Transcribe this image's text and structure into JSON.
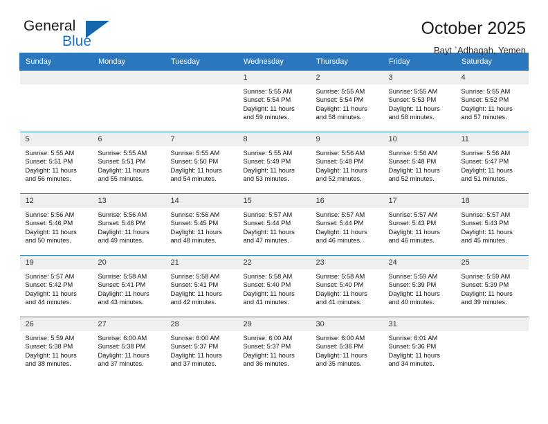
{
  "logo": {
    "word1": "General",
    "word2": "Blue",
    "triangle_color": "#1466ab",
    "blue_color": "#1f77c2"
  },
  "header": {
    "title": "October 2025",
    "subtitle": "Bayt `Adhaqah, Yemen",
    "accent_color": "#2a77bd"
  },
  "weekdays": [
    "Sunday",
    "Monday",
    "Tuesday",
    "Wednesday",
    "Thursday",
    "Friday",
    "Saturday"
  ],
  "labels": {
    "sunrise": "Sunrise:",
    "sunset": "Sunset:",
    "daylight": "Daylight:"
  },
  "weeks": [
    [
      {
        "day": "",
        "empty": true
      },
      {
        "day": "",
        "empty": true
      },
      {
        "day": "",
        "empty": true
      },
      {
        "day": "1",
        "sunrise": "Sunrise: 5:55 AM",
        "sunset": "Sunset: 5:54 PM",
        "daylight_l1": "Daylight: 11 hours",
        "daylight_l2": "and 59 minutes."
      },
      {
        "day": "2",
        "sunrise": "Sunrise: 5:55 AM",
        "sunset": "Sunset: 5:54 PM",
        "daylight_l1": "Daylight: 11 hours",
        "daylight_l2": "and 58 minutes."
      },
      {
        "day": "3",
        "sunrise": "Sunrise: 5:55 AM",
        "sunset": "Sunset: 5:53 PM",
        "daylight_l1": "Daylight: 11 hours",
        "daylight_l2": "and 58 minutes."
      },
      {
        "day": "4",
        "sunrise": "Sunrise: 5:55 AM",
        "sunset": "Sunset: 5:52 PM",
        "daylight_l1": "Daylight: 11 hours",
        "daylight_l2": "and 57 minutes."
      }
    ],
    [
      {
        "day": "5",
        "sunrise": "Sunrise: 5:55 AM",
        "sunset": "Sunset: 5:51 PM",
        "daylight_l1": "Daylight: 11 hours",
        "daylight_l2": "and 56 minutes."
      },
      {
        "day": "6",
        "sunrise": "Sunrise: 5:55 AM",
        "sunset": "Sunset: 5:51 PM",
        "daylight_l1": "Daylight: 11 hours",
        "daylight_l2": "and 55 minutes."
      },
      {
        "day": "7",
        "sunrise": "Sunrise: 5:55 AM",
        "sunset": "Sunset: 5:50 PM",
        "daylight_l1": "Daylight: 11 hours",
        "daylight_l2": "and 54 minutes."
      },
      {
        "day": "8",
        "sunrise": "Sunrise: 5:55 AM",
        "sunset": "Sunset: 5:49 PM",
        "daylight_l1": "Daylight: 11 hours",
        "daylight_l2": "and 53 minutes."
      },
      {
        "day": "9",
        "sunrise": "Sunrise: 5:56 AM",
        "sunset": "Sunset: 5:48 PM",
        "daylight_l1": "Daylight: 11 hours",
        "daylight_l2": "and 52 minutes."
      },
      {
        "day": "10",
        "sunrise": "Sunrise: 5:56 AM",
        "sunset": "Sunset: 5:48 PM",
        "daylight_l1": "Daylight: 11 hours",
        "daylight_l2": "and 52 minutes."
      },
      {
        "day": "11",
        "sunrise": "Sunrise: 5:56 AM",
        "sunset": "Sunset: 5:47 PM",
        "daylight_l1": "Daylight: 11 hours",
        "daylight_l2": "and 51 minutes."
      }
    ],
    [
      {
        "day": "12",
        "sunrise": "Sunrise: 5:56 AM",
        "sunset": "Sunset: 5:46 PM",
        "daylight_l1": "Daylight: 11 hours",
        "daylight_l2": "and 50 minutes."
      },
      {
        "day": "13",
        "sunrise": "Sunrise: 5:56 AM",
        "sunset": "Sunset: 5:46 PM",
        "daylight_l1": "Daylight: 11 hours",
        "daylight_l2": "and 49 minutes."
      },
      {
        "day": "14",
        "sunrise": "Sunrise: 5:56 AM",
        "sunset": "Sunset: 5:45 PM",
        "daylight_l1": "Daylight: 11 hours",
        "daylight_l2": "and 48 minutes."
      },
      {
        "day": "15",
        "sunrise": "Sunrise: 5:57 AM",
        "sunset": "Sunset: 5:44 PM",
        "daylight_l1": "Daylight: 11 hours",
        "daylight_l2": "and 47 minutes."
      },
      {
        "day": "16",
        "sunrise": "Sunrise: 5:57 AM",
        "sunset": "Sunset: 5:44 PM",
        "daylight_l1": "Daylight: 11 hours",
        "daylight_l2": "and 46 minutes."
      },
      {
        "day": "17",
        "sunrise": "Sunrise: 5:57 AM",
        "sunset": "Sunset: 5:43 PM",
        "daylight_l1": "Daylight: 11 hours",
        "daylight_l2": "and 46 minutes."
      },
      {
        "day": "18",
        "sunrise": "Sunrise: 5:57 AM",
        "sunset": "Sunset: 5:43 PM",
        "daylight_l1": "Daylight: 11 hours",
        "daylight_l2": "and 45 minutes."
      }
    ],
    [
      {
        "day": "19",
        "sunrise": "Sunrise: 5:57 AM",
        "sunset": "Sunset: 5:42 PM",
        "daylight_l1": "Daylight: 11 hours",
        "daylight_l2": "and 44 minutes."
      },
      {
        "day": "20",
        "sunrise": "Sunrise: 5:58 AM",
        "sunset": "Sunset: 5:41 PM",
        "daylight_l1": "Daylight: 11 hours",
        "daylight_l2": "and 43 minutes."
      },
      {
        "day": "21",
        "sunrise": "Sunrise: 5:58 AM",
        "sunset": "Sunset: 5:41 PM",
        "daylight_l1": "Daylight: 11 hours",
        "daylight_l2": "and 42 minutes."
      },
      {
        "day": "22",
        "sunrise": "Sunrise: 5:58 AM",
        "sunset": "Sunset: 5:40 PM",
        "daylight_l1": "Daylight: 11 hours",
        "daylight_l2": "and 41 minutes."
      },
      {
        "day": "23",
        "sunrise": "Sunrise: 5:58 AM",
        "sunset": "Sunset: 5:40 PM",
        "daylight_l1": "Daylight: 11 hours",
        "daylight_l2": "and 41 minutes."
      },
      {
        "day": "24",
        "sunrise": "Sunrise: 5:59 AM",
        "sunset": "Sunset: 5:39 PM",
        "daylight_l1": "Daylight: 11 hours",
        "daylight_l2": "and 40 minutes."
      },
      {
        "day": "25",
        "sunrise": "Sunrise: 5:59 AM",
        "sunset": "Sunset: 5:39 PM",
        "daylight_l1": "Daylight: 11 hours",
        "daylight_l2": "and 39 minutes."
      }
    ],
    [
      {
        "day": "26",
        "sunrise": "Sunrise: 5:59 AM",
        "sunset": "Sunset: 5:38 PM",
        "daylight_l1": "Daylight: 11 hours",
        "daylight_l2": "and 38 minutes."
      },
      {
        "day": "27",
        "sunrise": "Sunrise: 6:00 AM",
        "sunset": "Sunset: 5:38 PM",
        "daylight_l1": "Daylight: 11 hours",
        "daylight_l2": "and 37 minutes."
      },
      {
        "day": "28",
        "sunrise": "Sunrise: 6:00 AM",
        "sunset": "Sunset: 5:37 PM",
        "daylight_l1": "Daylight: 11 hours",
        "daylight_l2": "and 37 minutes."
      },
      {
        "day": "29",
        "sunrise": "Sunrise: 6:00 AM",
        "sunset": "Sunset: 5:37 PM",
        "daylight_l1": "Daylight: 11 hours",
        "daylight_l2": "and 36 minutes."
      },
      {
        "day": "30",
        "sunrise": "Sunrise: 6:00 AM",
        "sunset": "Sunset: 5:36 PM",
        "daylight_l1": "Daylight: 11 hours",
        "daylight_l2": "and 35 minutes."
      },
      {
        "day": "31",
        "sunrise": "Sunrise: 6:01 AM",
        "sunset": "Sunset: 5:36 PM",
        "daylight_l1": "Daylight: 11 hours",
        "daylight_l2": "and 34 minutes."
      },
      {
        "day": "",
        "empty": true
      }
    ]
  ]
}
